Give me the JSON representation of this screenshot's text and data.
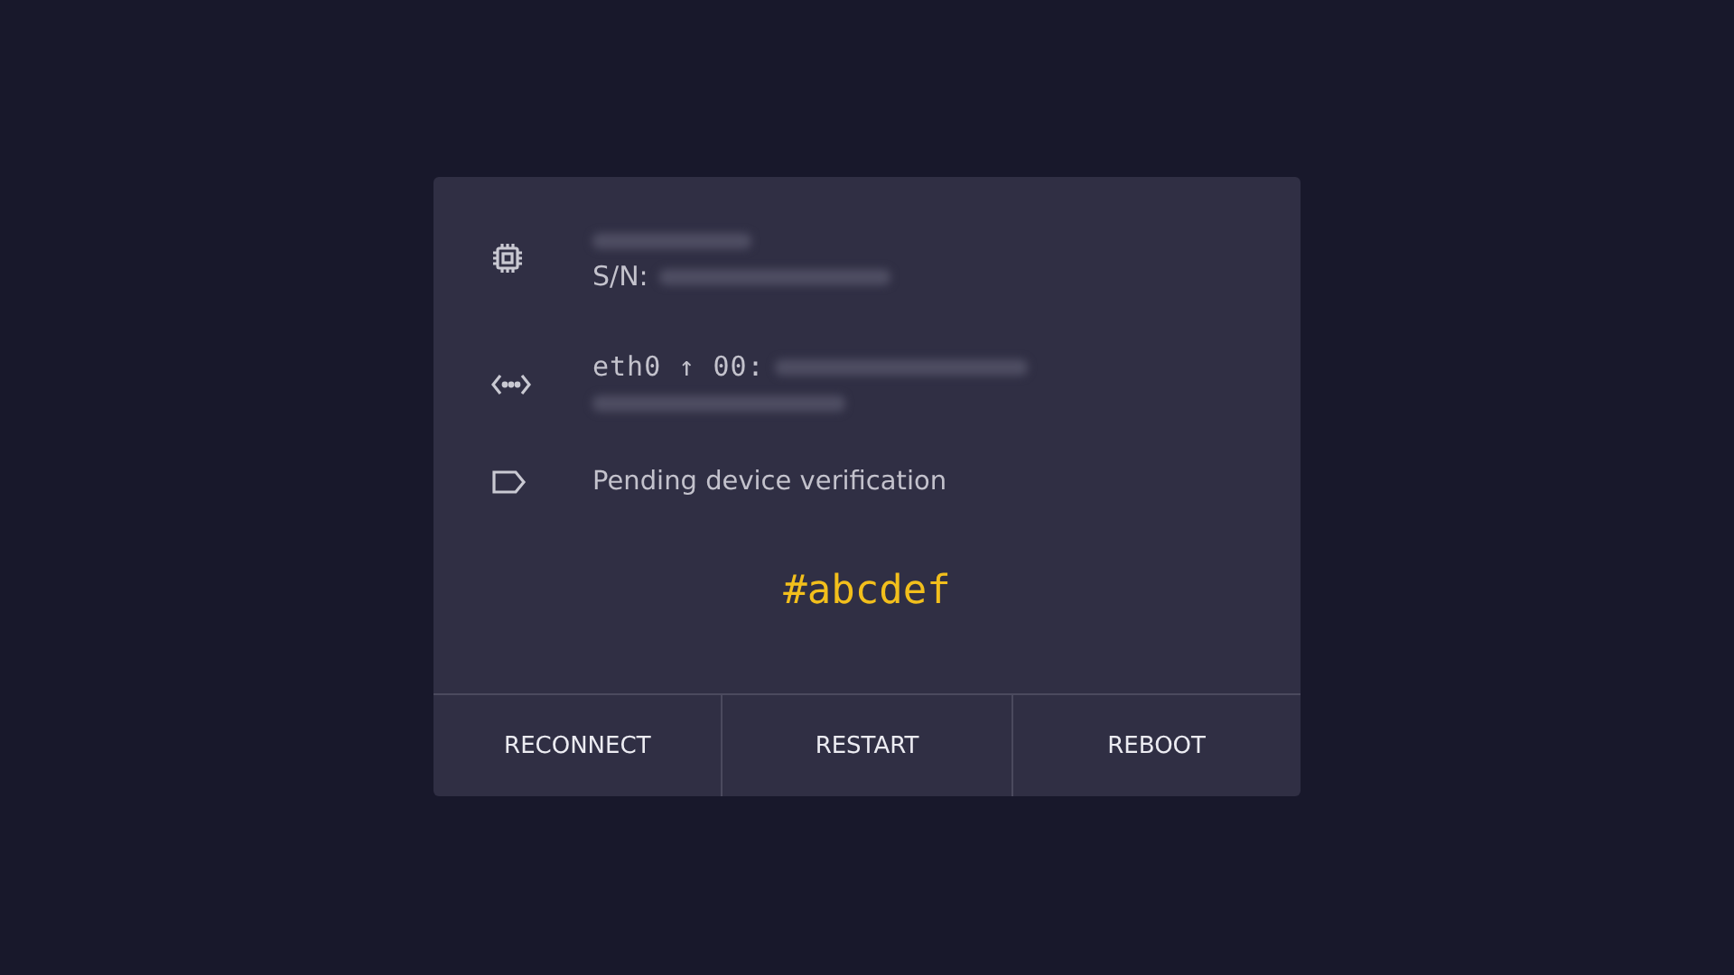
{
  "info_rows": [
    {
      "kind": "chip",
      "lines": [
        {
          "redacted": true
        },
        {
          "prefix": "S/N:",
          "redacted": true
        }
      ]
    },
    {
      "kind": "network",
      "lines": [
        {
          "prefix": "eth0 ↑ 00:",
          "redacted": true
        },
        {
          "redacted": true
        }
      ]
    },
    {
      "kind": "tag",
      "lines": [
        {
          "prefix": "Pending device verification",
          "redacted": false
        }
      ]
    }
  ],
  "color_code": "#abcdef",
  "buttons": [
    "RECONNECT",
    "RESTART",
    "REBOOT"
  ]
}
